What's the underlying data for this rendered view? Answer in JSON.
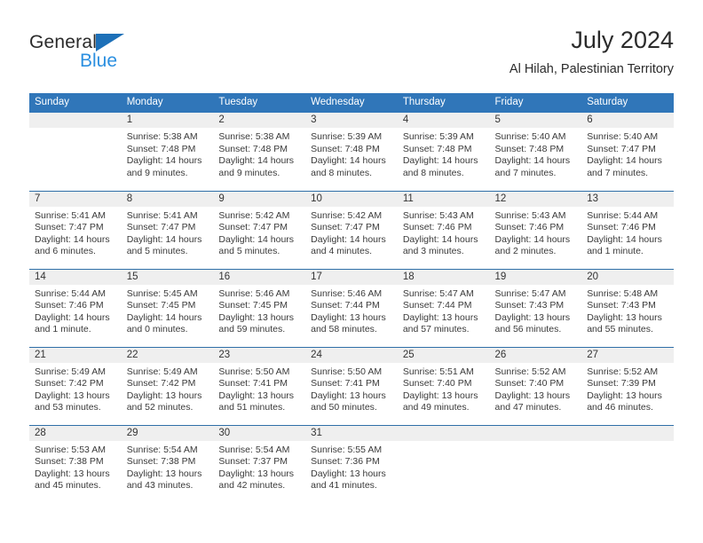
{
  "brand": {
    "name_dark": "General",
    "name_blue": "Blue",
    "accent_color": "#2b8fe0",
    "triangle_color": "#1d70b8"
  },
  "header": {
    "title": "July 2024",
    "subtitle": "Al Hilah, Palestinian Territory"
  },
  "theme": {
    "header_row_bg": "#3076b9",
    "week_separator": "#2f6fa8",
    "daynum_band_bg": "#efefef"
  },
  "weekday_headers": [
    "Sunday",
    "Monday",
    "Tuesday",
    "Wednesday",
    "Thursday",
    "Friday",
    "Saturday"
  ],
  "weeks": [
    [
      {
        "day": "",
        "sunrise": "",
        "sunset": "",
        "daylight_1": "",
        "daylight_2": ""
      },
      {
        "day": "1",
        "sunrise": "Sunrise: 5:38 AM",
        "sunset": "Sunset: 7:48 PM",
        "daylight_1": "Daylight: 14 hours",
        "daylight_2": "and 9 minutes."
      },
      {
        "day": "2",
        "sunrise": "Sunrise: 5:38 AM",
        "sunset": "Sunset: 7:48 PM",
        "daylight_1": "Daylight: 14 hours",
        "daylight_2": "and 9 minutes."
      },
      {
        "day": "3",
        "sunrise": "Sunrise: 5:39 AM",
        "sunset": "Sunset: 7:48 PM",
        "daylight_1": "Daylight: 14 hours",
        "daylight_2": "and 8 minutes."
      },
      {
        "day": "4",
        "sunrise": "Sunrise: 5:39 AM",
        "sunset": "Sunset: 7:48 PM",
        "daylight_1": "Daylight: 14 hours",
        "daylight_2": "and 8 minutes."
      },
      {
        "day": "5",
        "sunrise": "Sunrise: 5:40 AM",
        "sunset": "Sunset: 7:48 PM",
        "daylight_1": "Daylight: 14 hours",
        "daylight_2": "and 7 minutes."
      },
      {
        "day": "6",
        "sunrise": "Sunrise: 5:40 AM",
        "sunset": "Sunset: 7:47 PM",
        "daylight_1": "Daylight: 14 hours",
        "daylight_2": "and 7 minutes."
      }
    ],
    [
      {
        "day": "7",
        "sunrise": "Sunrise: 5:41 AM",
        "sunset": "Sunset: 7:47 PM",
        "daylight_1": "Daylight: 14 hours",
        "daylight_2": "and 6 minutes."
      },
      {
        "day": "8",
        "sunrise": "Sunrise: 5:41 AM",
        "sunset": "Sunset: 7:47 PM",
        "daylight_1": "Daylight: 14 hours",
        "daylight_2": "and 5 minutes."
      },
      {
        "day": "9",
        "sunrise": "Sunrise: 5:42 AM",
        "sunset": "Sunset: 7:47 PM",
        "daylight_1": "Daylight: 14 hours",
        "daylight_2": "and 5 minutes."
      },
      {
        "day": "10",
        "sunrise": "Sunrise: 5:42 AM",
        "sunset": "Sunset: 7:47 PM",
        "daylight_1": "Daylight: 14 hours",
        "daylight_2": "and 4 minutes."
      },
      {
        "day": "11",
        "sunrise": "Sunrise: 5:43 AM",
        "sunset": "Sunset: 7:46 PM",
        "daylight_1": "Daylight: 14 hours",
        "daylight_2": "and 3 minutes."
      },
      {
        "day": "12",
        "sunrise": "Sunrise: 5:43 AM",
        "sunset": "Sunset: 7:46 PM",
        "daylight_1": "Daylight: 14 hours",
        "daylight_2": "and 2 minutes."
      },
      {
        "day": "13",
        "sunrise": "Sunrise: 5:44 AM",
        "sunset": "Sunset: 7:46 PM",
        "daylight_1": "Daylight: 14 hours",
        "daylight_2": "and 1 minute."
      }
    ],
    [
      {
        "day": "14",
        "sunrise": "Sunrise: 5:44 AM",
        "sunset": "Sunset: 7:46 PM",
        "daylight_1": "Daylight: 14 hours",
        "daylight_2": "and 1 minute."
      },
      {
        "day": "15",
        "sunrise": "Sunrise: 5:45 AM",
        "sunset": "Sunset: 7:45 PM",
        "daylight_1": "Daylight: 14 hours",
        "daylight_2": "and 0 minutes."
      },
      {
        "day": "16",
        "sunrise": "Sunrise: 5:46 AM",
        "sunset": "Sunset: 7:45 PM",
        "daylight_1": "Daylight: 13 hours",
        "daylight_2": "and 59 minutes."
      },
      {
        "day": "17",
        "sunrise": "Sunrise: 5:46 AM",
        "sunset": "Sunset: 7:44 PM",
        "daylight_1": "Daylight: 13 hours",
        "daylight_2": "and 58 minutes."
      },
      {
        "day": "18",
        "sunrise": "Sunrise: 5:47 AM",
        "sunset": "Sunset: 7:44 PM",
        "daylight_1": "Daylight: 13 hours",
        "daylight_2": "and 57 minutes."
      },
      {
        "day": "19",
        "sunrise": "Sunrise: 5:47 AM",
        "sunset": "Sunset: 7:43 PM",
        "daylight_1": "Daylight: 13 hours",
        "daylight_2": "and 56 minutes."
      },
      {
        "day": "20",
        "sunrise": "Sunrise: 5:48 AM",
        "sunset": "Sunset: 7:43 PM",
        "daylight_1": "Daylight: 13 hours",
        "daylight_2": "and 55 minutes."
      }
    ],
    [
      {
        "day": "21",
        "sunrise": "Sunrise: 5:49 AM",
        "sunset": "Sunset: 7:42 PM",
        "daylight_1": "Daylight: 13 hours",
        "daylight_2": "and 53 minutes."
      },
      {
        "day": "22",
        "sunrise": "Sunrise: 5:49 AM",
        "sunset": "Sunset: 7:42 PM",
        "daylight_1": "Daylight: 13 hours",
        "daylight_2": "and 52 minutes."
      },
      {
        "day": "23",
        "sunrise": "Sunrise: 5:50 AM",
        "sunset": "Sunset: 7:41 PM",
        "daylight_1": "Daylight: 13 hours",
        "daylight_2": "and 51 minutes."
      },
      {
        "day": "24",
        "sunrise": "Sunrise: 5:50 AM",
        "sunset": "Sunset: 7:41 PM",
        "daylight_1": "Daylight: 13 hours",
        "daylight_2": "and 50 minutes."
      },
      {
        "day": "25",
        "sunrise": "Sunrise: 5:51 AM",
        "sunset": "Sunset: 7:40 PM",
        "daylight_1": "Daylight: 13 hours",
        "daylight_2": "and 49 minutes."
      },
      {
        "day": "26",
        "sunrise": "Sunrise: 5:52 AM",
        "sunset": "Sunset: 7:40 PM",
        "daylight_1": "Daylight: 13 hours",
        "daylight_2": "and 47 minutes."
      },
      {
        "day": "27",
        "sunrise": "Sunrise: 5:52 AM",
        "sunset": "Sunset: 7:39 PM",
        "daylight_1": "Daylight: 13 hours",
        "daylight_2": "and 46 minutes."
      }
    ],
    [
      {
        "day": "28",
        "sunrise": "Sunrise: 5:53 AM",
        "sunset": "Sunset: 7:38 PM",
        "daylight_1": "Daylight: 13 hours",
        "daylight_2": "and 45 minutes."
      },
      {
        "day": "29",
        "sunrise": "Sunrise: 5:54 AM",
        "sunset": "Sunset: 7:38 PM",
        "daylight_1": "Daylight: 13 hours",
        "daylight_2": "and 43 minutes."
      },
      {
        "day": "30",
        "sunrise": "Sunrise: 5:54 AM",
        "sunset": "Sunset: 7:37 PM",
        "daylight_1": "Daylight: 13 hours",
        "daylight_2": "and 42 minutes."
      },
      {
        "day": "31",
        "sunrise": "Sunrise: 5:55 AM",
        "sunset": "Sunset: 7:36 PM",
        "daylight_1": "Daylight: 13 hours",
        "daylight_2": "and 41 minutes."
      },
      {
        "day": "",
        "sunrise": "",
        "sunset": "",
        "daylight_1": "",
        "daylight_2": ""
      },
      {
        "day": "",
        "sunrise": "",
        "sunset": "",
        "daylight_1": "",
        "daylight_2": ""
      },
      {
        "day": "",
        "sunrise": "",
        "sunset": "",
        "daylight_1": "",
        "daylight_2": ""
      }
    ]
  ]
}
